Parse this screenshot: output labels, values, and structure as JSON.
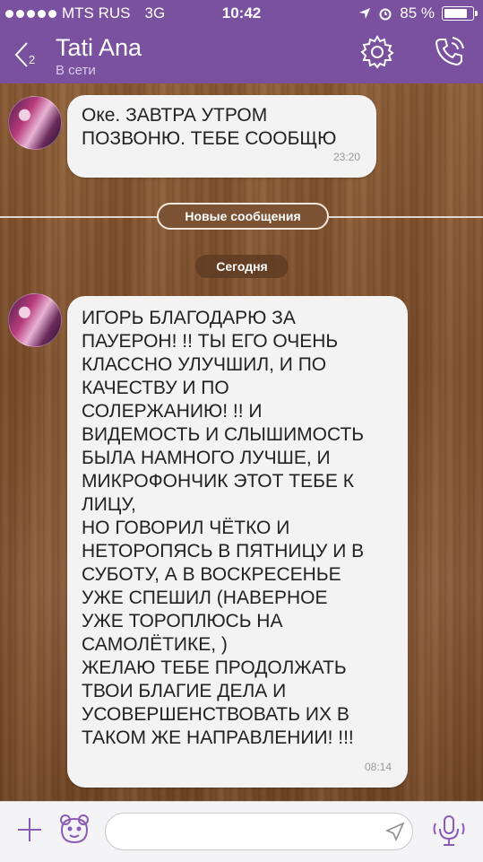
{
  "status_bar": {
    "carrier": "MTS RUS",
    "network": "3G",
    "time": "10:42",
    "battery": "85 %",
    "battery_level": 0.85
  },
  "header": {
    "back_count": "2",
    "contact_name": "Tati Ana",
    "contact_status": "В сети"
  },
  "messages": [
    {
      "text": "Оке. ЗАВТРА УТРОМ\nПОЗВОНЮ. ТЕБЕ СООБЩЮ",
      "time": "23:20"
    },
    {
      "text": "ИГОРЬ БЛАГОДАРЮ ЗА\nПАУЕРОН! !! ТЫ ЕГО ОЧЕНЬ\nКЛАССНО УЛУЧШИЛ,  И ПО\nКАЧЕСТВУ И ПО\nСОЛЕРЖАНИЮ! !! И\nВИДЕМОСТЬ И СЛЫШИМОСТЬ\nБЫЛА НАМНОГО ЛУЧШЕ,  И\nМИКРОФОНЧИК ЭТОТ  ТЕБЕ К\nЛИЦУ,\nНО ГОВОРИЛ ЧЁТКО И\nНЕТОРОПЯСЬ В ПЯТНИЦУ И В\nСУБОТУ,  А  В ВОСКРЕСЕНЬЕ\nУЖЕ СПЕШИЛ (НАВЕРНОЕ\nУЖЕ  ТОРОПЛЮСЬ НА\nСАМОЛЁТИКЕ, )\nЖЕЛАЮ ТЕБЕ ПРОДОЛЖАТЬ\nТВОИ БЛАГИЕ ДЕЛА И\nУСОВЕРШЕНСТВОВАТЬ ИХ В\nТАКОМ ЖЕ НАПРАВЛЕНИИ! !!!",
      "time": "08:14"
    }
  ],
  "dividers": {
    "new_messages": "Новые сообщения",
    "today": "Сегодня"
  },
  "input": {
    "value": "",
    "placeholder": ""
  },
  "colors": {
    "header": "#7a519f",
    "bubble": "#f3f3f3",
    "accent_icon": "#8a5bb6"
  },
  "icons": [
    "back-chevron-icon",
    "settings-gear-icon",
    "call-icon",
    "plus-icon",
    "sticker-bear-icon",
    "send-icon",
    "microphone-icon",
    "location-arrow-icon",
    "alarm-icon"
  ]
}
